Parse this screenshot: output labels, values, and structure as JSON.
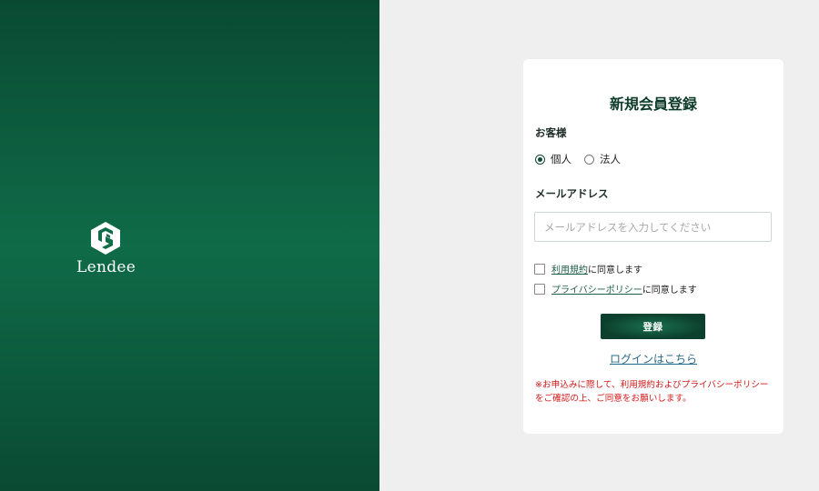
{
  "brand": {
    "name": "Lendee",
    "panel_color": "#0f6b48"
  },
  "form": {
    "title": "新規会員登録",
    "customer_label": "お客様",
    "customer_types": [
      {
        "label": "個人",
        "selected": true
      },
      {
        "label": "法人",
        "selected": false
      }
    ],
    "email_label": "メールアドレス",
    "email_value": "",
    "email_placeholder": "メールアドレスを入力してください",
    "agreements": [
      {
        "link": "利用規約",
        "suffix": "に同意します",
        "checked": false
      },
      {
        "link": "プライバシーポリシー",
        "suffix": "に同意します",
        "checked": false
      }
    ],
    "submit_label": "登録",
    "login_link": "ログインはこちら",
    "notice": "※お申込みに際して、利用規約およびプライバシーポリシーをご確認の上、ご同意をお願いします。"
  },
  "colors": {
    "accent": "#0d4a33",
    "notice": "#d01818",
    "link": "#2b6a8a"
  },
  "icons": [
    "lendee-logo-icon",
    "radio-checked-icon",
    "radio-unchecked-icon",
    "checkbox-icon"
  ]
}
